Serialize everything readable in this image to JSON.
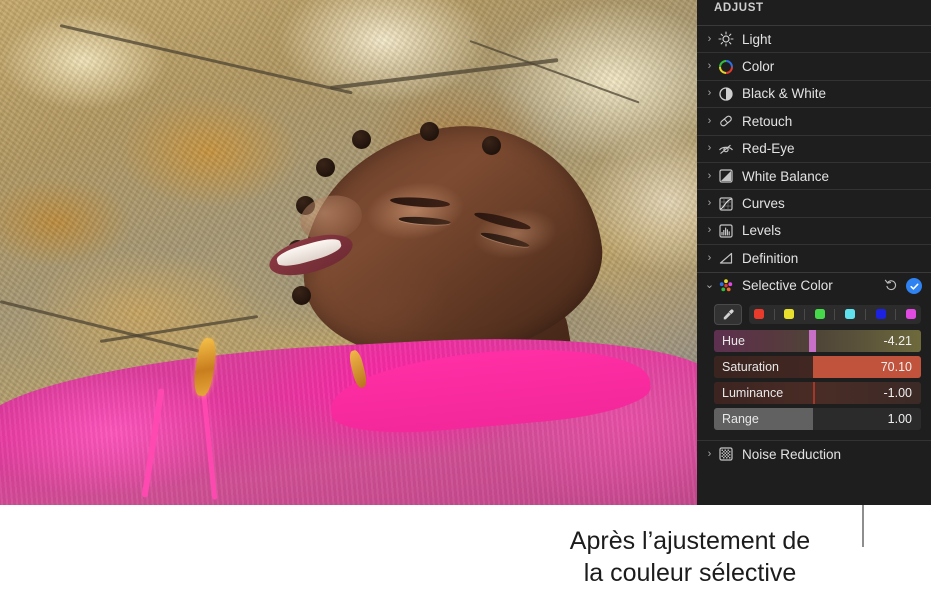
{
  "panel": {
    "section_title": "ADJUST",
    "items": [
      {
        "label": "Light",
        "icon": "sun-icon"
      },
      {
        "label": "Color",
        "icon": "color-wheel-icon"
      },
      {
        "label": "Black & White",
        "icon": "half-circle-icon"
      },
      {
        "label": "Retouch",
        "icon": "bandage-icon"
      },
      {
        "label": "Red-Eye",
        "icon": "eye-slash-icon"
      },
      {
        "label": "White Balance",
        "icon": "white-balance-icon"
      },
      {
        "label": "Curves",
        "icon": "curves-icon"
      },
      {
        "label": "Levels",
        "icon": "levels-icon"
      },
      {
        "label": "Definition",
        "icon": "definition-icon"
      }
    ],
    "expanded": {
      "label": "Selective Color",
      "icon": "selective-color-dots-icon",
      "reset_icon": "reset-arrow-icon",
      "confirm_icon": "checkmark-icon",
      "chevron_open": "⌄",
      "eyedropper_icon": "eyedropper-icon",
      "swatches": [
        {
          "name": "red",
          "color": "#e83b2c"
        },
        {
          "name": "yellow",
          "color": "#e8e02c"
        },
        {
          "name": "green",
          "color": "#46d94a"
        },
        {
          "name": "cyan",
          "color": "#5fe2ee"
        },
        {
          "name": "blue",
          "color": "#1c22e0"
        },
        {
          "name": "magenta",
          "color": "#e04ae0"
        }
      ],
      "sliders": [
        {
          "name": "Hue",
          "value": "-4.21"
        },
        {
          "name": "Saturation",
          "value": "70.10"
        },
        {
          "name": "Luminance",
          "value": "-1.00"
        },
        {
          "name": "Range",
          "value": "1.00"
        }
      ]
    },
    "trailing_item": {
      "label": "Noise Reduction",
      "icon": "noise-reduction-icon"
    },
    "chevron_closed": "›"
  },
  "caption": {
    "line1": "Après l’ajustement de",
    "line2": "la couleur sélective"
  },
  "colors": {
    "panel_bg": "#1e1e1e",
    "accent_blue": "#2f82f2",
    "hue_handle": "#c86fc8",
    "saturation_fill": "#c1523c"
  }
}
